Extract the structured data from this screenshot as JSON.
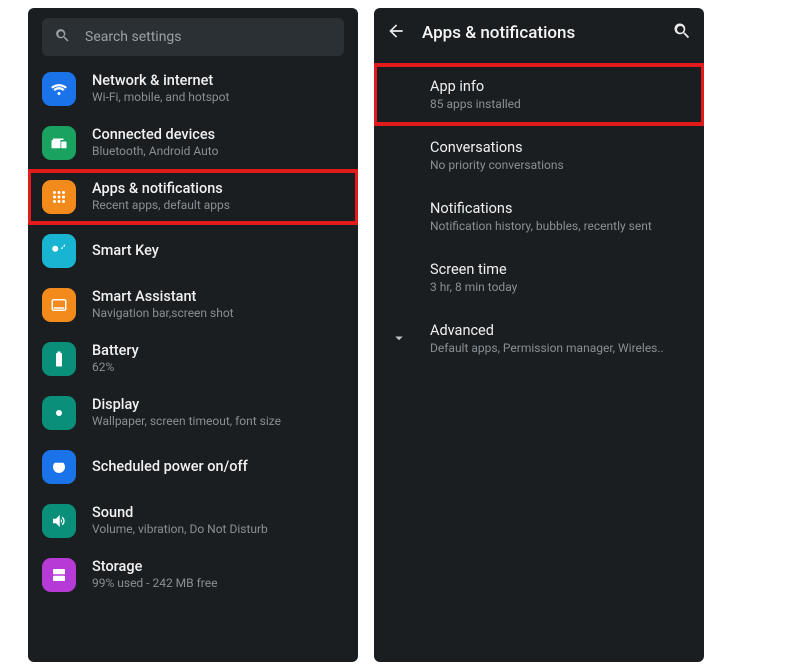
{
  "left": {
    "search_placeholder": "Search settings",
    "items": [
      {
        "title": "Network & internet",
        "sub": "Wi-Fi, mobile, and hotspot",
        "color": "#1a73e8",
        "icon": "wifi",
        "highlight": false
      },
      {
        "title": "Connected devices",
        "sub": "Bluetooth, Android Auto",
        "color": "#1aa260",
        "icon": "devices",
        "highlight": false
      },
      {
        "title": "Apps & notifications",
        "sub": "Recent apps, default apps",
        "color": "#f28b1c",
        "icon": "apps",
        "highlight": true
      },
      {
        "title": "Smart Key",
        "sub": "",
        "color": "#18b4d1",
        "icon": "key",
        "highlight": false
      },
      {
        "title": "Smart Assistant",
        "sub": "Navigation bar,screen shot",
        "color": "#f28b1c",
        "icon": "navbar",
        "highlight": false
      },
      {
        "title": "Battery",
        "sub": "62%",
        "color": "#0a8f7a",
        "icon": "battery",
        "highlight": false
      },
      {
        "title": "Display",
        "sub": "Wallpaper, screen timeout, font size",
        "color": "#0a8f7a",
        "icon": "display",
        "highlight": false
      },
      {
        "title": "Scheduled power on/off",
        "sub": "",
        "color": "#1a73e8",
        "icon": "power",
        "highlight": false
      },
      {
        "title": "Sound",
        "sub": "Volume, vibration, Do Not Disturb",
        "color": "#0a8f7a",
        "icon": "sound",
        "highlight": false
      },
      {
        "title": "Storage",
        "sub": "99% used - 242 MB free",
        "color": "#b63bd6",
        "icon": "storage",
        "highlight": false
      }
    ]
  },
  "right": {
    "title": "Apps & notifications",
    "items": [
      {
        "title": "App info",
        "sub": "85 apps installed",
        "highlight": true,
        "expand": false
      },
      {
        "title": "Conversations",
        "sub": "No priority conversations",
        "highlight": false,
        "expand": false
      },
      {
        "title": "Notifications",
        "sub": "Notification history, bubbles, recently sent",
        "highlight": false,
        "expand": false
      },
      {
        "title": "Screen time",
        "sub": "3 hr, 8 min today",
        "highlight": false,
        "expand": false
      },
      {
        "title": "Advanced",
        "sub": "Default apps, Permission manager, Wireles..",
        "highlight": false,
        "expand": true
      }
    ]
  }
}
